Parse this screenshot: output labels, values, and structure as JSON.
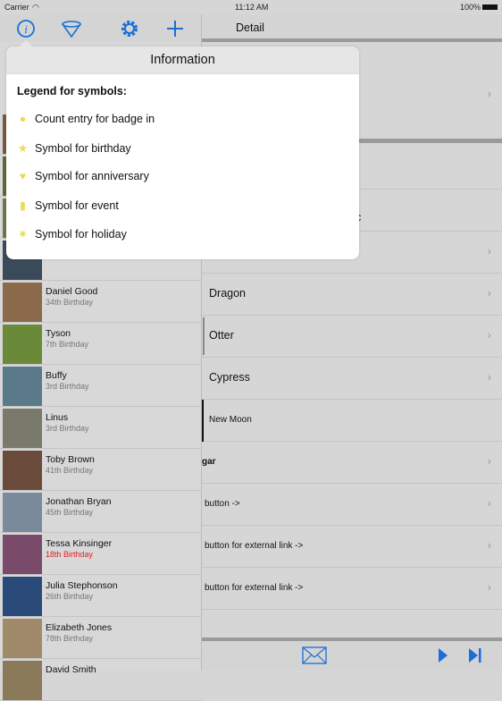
{
  "status": {
    "carrier": "Carrier",
    "time": "11:12 AM",
    "battery": "100%"
  },
  "nav": {
    "detail_title": "Detail",
    "icons": [
      "info-icon",
      "filter-icon",
      "gear-icon",
      "plus-icon"
    ]
  },
  "popover": {
    "title": "Information",
    "legend_title": "Legend for symbols:",
    "items": [
      {
        "icon": "badge-count-icon",
        "label": "Count entry for badge in"
      },
      {
        "icon": "star-icon",
        "label": "Symbol for birthday"
      },
      {
        "icon": "heart-icon",
        "label": "Symbol for anniversary"
      },
      {
        "icon": "event-icon",
        "label": "Symbol for event"
      },
      {
        "icon": "sun-icon",
        "label": "Symbol for holiday"
      }
    ]
  },
  "people": [
    {
      "name": "Daniel Good",
      "sub": "34th Birthday"
    },
    {
      "name": "Tyson",
      "sub": "7th Birthday"
    },
    {
      "name": "Buffy",
      "sub": "3rd Birthday"
    },
    {
      "name": "Linus",
      "sub": "3rd Birthday"
    },
    {
      "name": "Toby Brown",
      "sub": "41th Birthday"
    },
    {
      "name": "Jonathan Bryan",
      "sub": "45th Birthday"
    },
    {
      "name": "Tessa Kinsinger",
      "sub": "18th Birthday",
      "highlight": true
    },
    {
      "name": "Julia Stephonson",
      "sub": "26th Birthday"
    },
    {
      "name": "Elizabeth Jones",
      "sub": "78th Birthday"
    },
    {
      "name": "David Smith",
      "sub": ""
    }
  ],
  "detail": {
    "partial_c": "c",
    "rows": [
      "Dragon",
      "Otter",
      "Cypress",
      "New Moon",
      "gar",
      "button ->",
      "button for external link ->",
      "button for external link ->"
    ]
  },
  "colors": {
    "accent": "#1a6fd8",
    "highlight": "#d22222"
  }
}
